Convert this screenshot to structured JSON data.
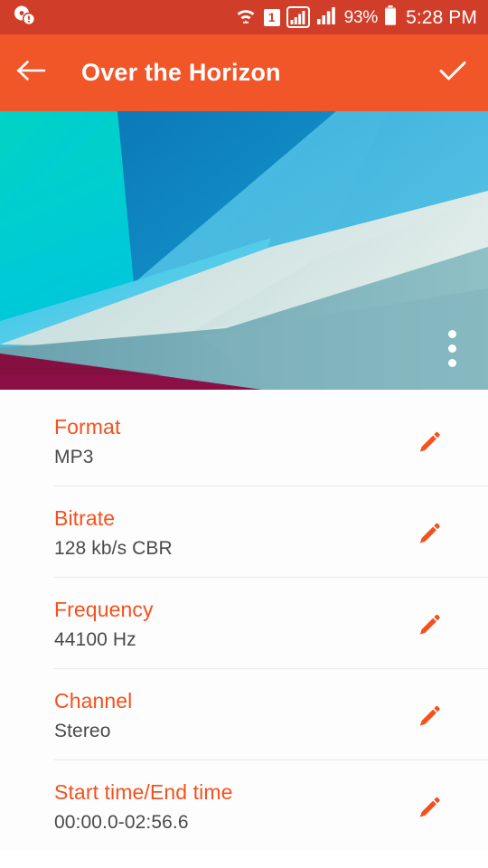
{
  "status_bar": {
    "background_color": "#d03e2a",
    "notification_icon": "disc-alert-icon",
    "wifi_icon": "wifi-icon",
    "sim_badge": "1",
    "signal_primary_icon": "cellular-signal-boxed-icon",
    "signal_secondary_icon": "cellular-signal-icon",
    "battery_percent": "93%",
    "battery_icon": "battery-icon",
    "clock": "5:28 PM"
  },
  "app_bar": {
    "background_color": "#f05628",
    "back_icon": "back-arrow-icon",
    "title": "Over the Horizon",
    "confirm_icon": "check-icon"
  },
  "artwork": {
    "name": "album-art",
    "overflow_icon": "overflow-menu-icon",
    "colors": {
      "teal": "#00c8cf",
      "cyan": "#14c9e8",
      "blue_dark": "#0f86bf",
      "blue_mid": "#2fa8d8",
      "blue_light": "#6fc7e2",
      "pale": "#c9dfe0",
      "pale_2": "#d5e6e6",
      "steel": "#6fa5b2",
      "magenta": "#8c1045"
    }
  },
  "details": {
    "rows": [
      {
        "label": "Format",
        "value": "MP3",
        "edit_icon": "pencil-icon"
      },
      {
        "label": "Bitrate",
        "value": "128 kb/s CBR",
        "edit_icon": "pencil-icon"
      },
      {
        "label": "Frequency",
        "value": "44100 Hz",
        "edit_icon": "pencil-icon"
      },
      {
        "label": "Channel",
        "value": "Stereo",
        "edit_icon": "pencil-icon"
      },
      {
        "label": "Start time/End time",
        "value": "00:00.0-02:56.6",
        "edit_icon": "pencil-icon"
      }
    ],
    "accent_color": "#f4511e",
    "value_color": "#4a4a4a"
  }
}
